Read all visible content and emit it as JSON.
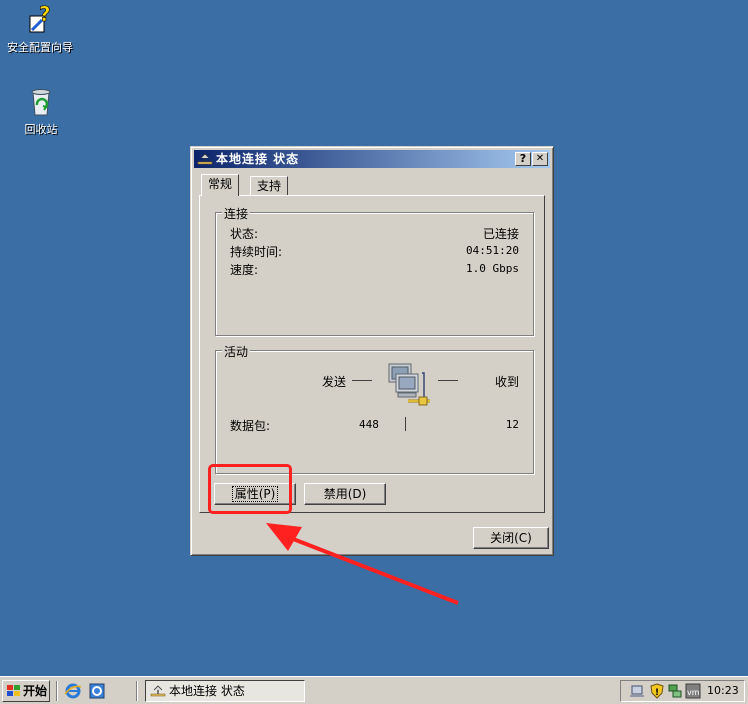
{
  "desktop": {
    "icons": [
      {
        "label": "安全配置向导",
        "icon": "security-wizard-icon"
      },
      {
        "label": "回收站",
        "icon": "recycle-bin-icon"
      }
    ]
  },
  "dialog": {
    "title": "本地连接 状态",
    "help_glyph": "?",
    "close_glyph": "✕",
    "tabs": [
      {
        "label": "常规",
        "active": true
      },
      {
        "label": "支持",
        "active": false
      }
    ],
    "connection": {
      "group_title": "连接",
      "rows": [
        {
          "label": "状态:",
          "value": "已连接"
        },
        {
          "label": "持续时间:",
          "value": "04:51:20"
        },
        {
          "label": "速度:",
          "value": "1.0 Gbps"
        }
      ]
    },
    "activity": {
      "group_title": "活动",
      "sent_label": "发送",
      "received_label": "收到",
      "packets_label": "数据包:",
      "packets_sent": "448",
      "packets_received": "12"
    },
    "buttons": {
      "properties": "属性(P)",
      "disable": "禁用(D)",
      "close": "关闭(C)"
    }
  },
  "taskbar": {
    "start_label": "开始",
    "task_label": "本地连接 状态",
    "clock": "10:23"
  },
  "colors": {
    "desktop": "#3a6ea5",
    "title_gradient_start": "#0a246a",
    "title_gradient_end": "#a6caf0",
    "annotation": "#ff2020"
  }
}
